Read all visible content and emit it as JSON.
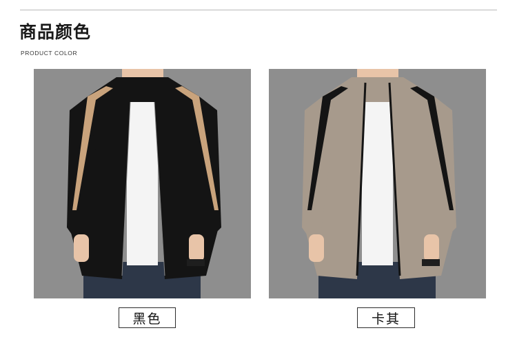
{
  "header": {
    "title": "商品颜色",
    "subtitle": "PRODUCT COLOR"
  },
  "products": [
    {
      "color_label": "黑色",
      "sweater_color": "#141414",
      "stripe_color": "#c9a37c"
    },
    {
      "color_label": "卡其",
      "sweater_color": "#a79a8c",
      "stripe_color": "#141414"
    }
  ],
  "colors": {
    "photo_background": "#8e8e8e",
    "shirt": "#f4f4f4",
    "jeans": "#2d3748",
    "skin": "#e8c4a8"
  }
}
